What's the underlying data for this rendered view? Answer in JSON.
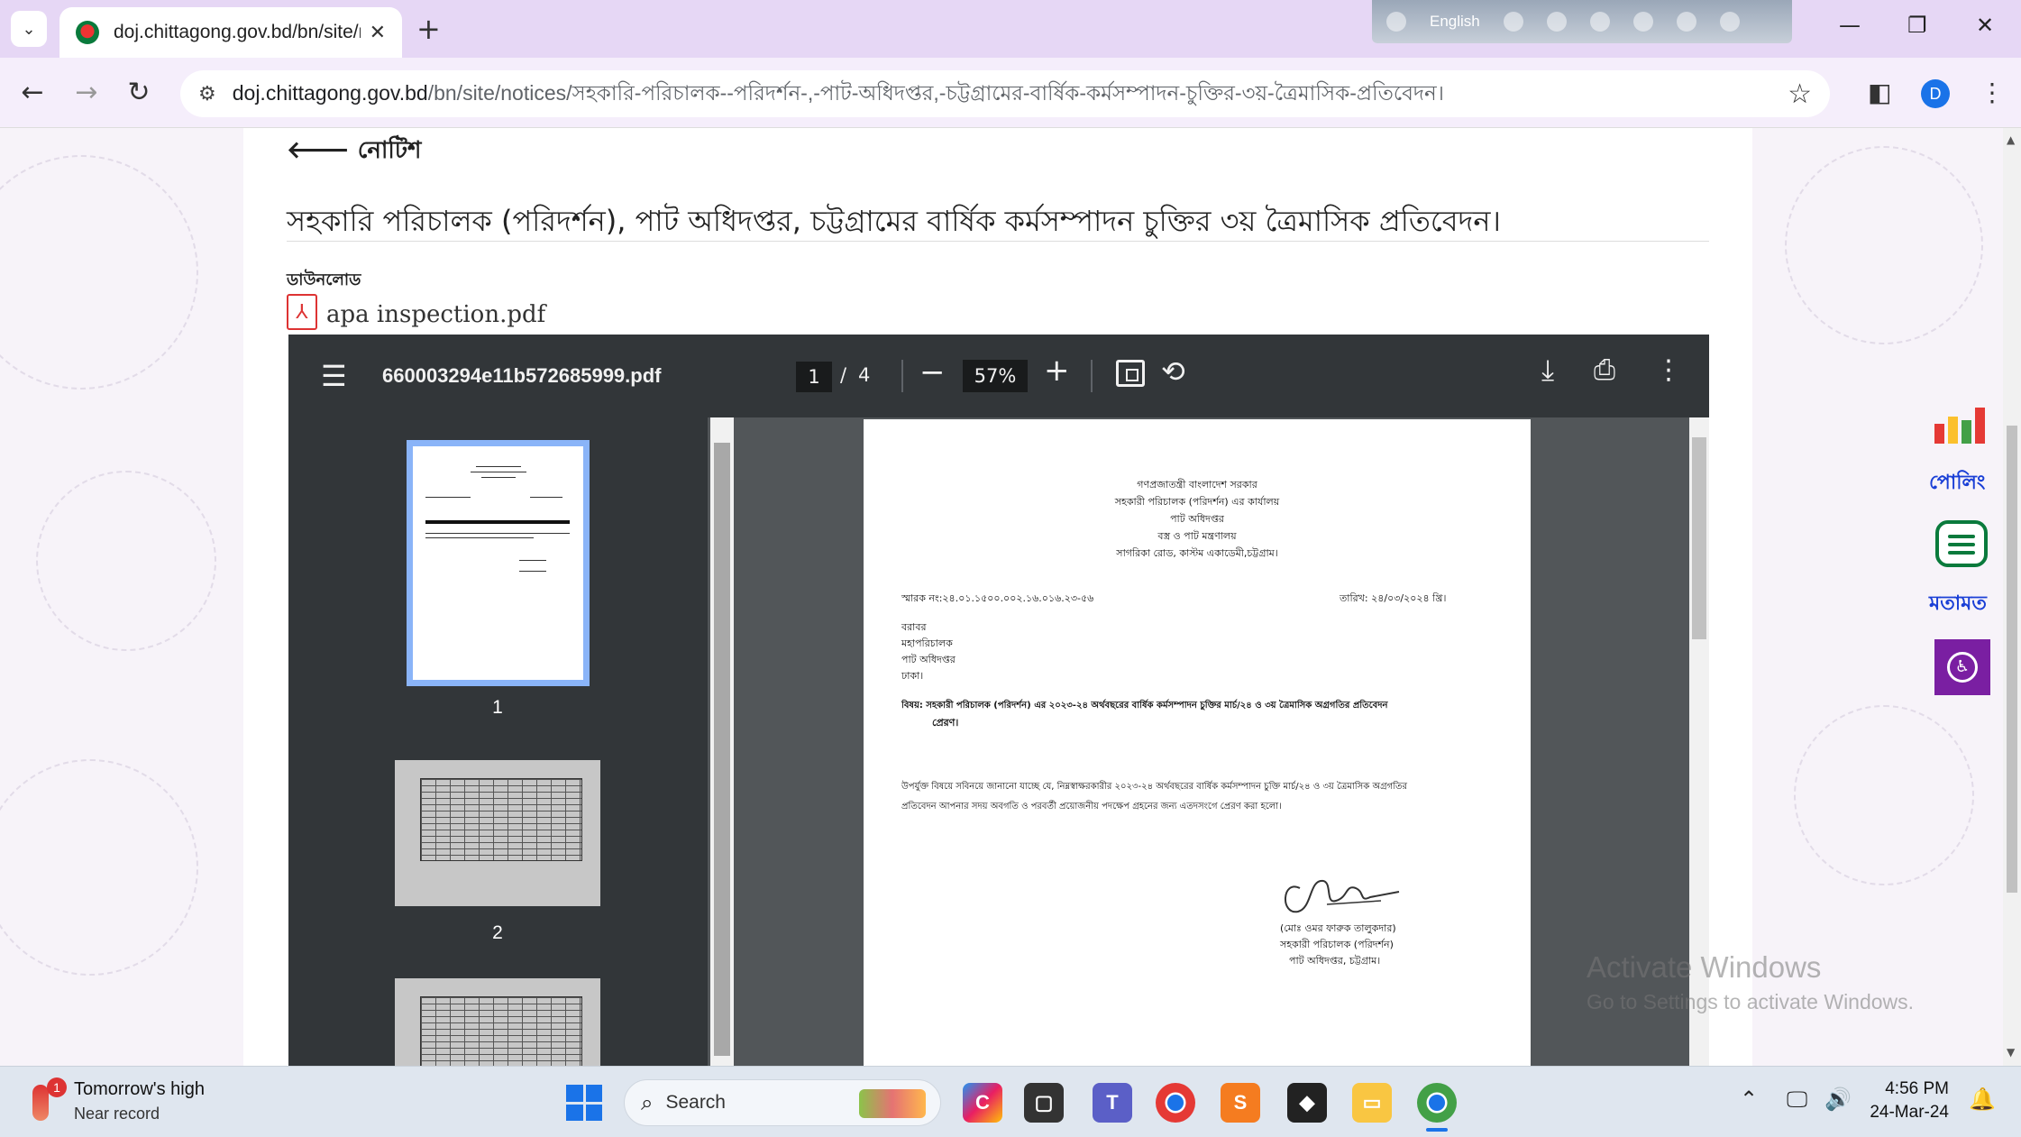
{
  "browser": {
    "tab_title": "doj.chittagong.gov.bd/bn/site/n",
    "url_host": "doj.chittagong.gov.bd",
    "url_path": "/bn/site/notices/সহকারি-পরিচালক--পরিদর্শন-,-পাট-অধিদপ্তর,-চট্টগ্রামের-বার্ষিক-কর্মসম্পাদন-চুক্তির-৩য়-ত্রৈমাসিক-প্রতিবেদন।",
    "language_bar_label": "English",
    "profile_initial": "D"
  },
  "page": {
    "back_label": "নোটিশ",
    "notice_title": "সহকারি পরিচালক (পরিদর্শন), পাট অধিদপ্তর, চট্টগ্রামের বার্ষিক কর্মসম্পাদন চুক্তির ৩য় ত্রৈমাসিক প্রতিবেদন।",
    "download_label": "ডাউনলোড",
    "attachment_name": "apa inspection.pdf"
  },
  "pdf_viewer": {
    "file_name": "660003294e11b572685999.pdf",
    "current_page": "1",
    "page_separator": "/",
    "total_pages": "4",
    "zoom": "57%",
    "thumbnails": [
      {
        "number": "1"
      },
      {
        "number": "2"
      }
    ],
    "document": {
      "header_lines": [
        "গণপ্রজাতন্ত্রী বাংলাদেশ সরকার",
        "সহকারী পরিচালক (পরিদর্শন) এর কার্যালয়",
        "পাট অধিদপ্তর",
        "বস্ত্র ও পাট মন্ত্রণালয়",
        "সাগরিকা রোড, কাস্টম একাডেমী,চট্টগ্রাম।"
      ],
      "memo_no": "স্মারক নং:২৪.০১.১৫০০.০০২.১৬.০১৬.২৩-৫৬",
      "date": "তারিখ: ২৪/০৩/২০২৪ খ্রি।",
      "recipient_lines": [
        "বরাবর",
        "মহাপরিচালক",
        "পাট অধিদপ্তর",
        "ঢাকা।"
      ],
      "subject_line1": "বিষয়: সহকারী পরিচালক (পরিদর্শন) এর ২০২৩-২৪ অর্থবছরের বার্ষিক কর্মসম্পাদন চুক্তির মার্চ/২৪ ও ৩য় ত্রৈমাসিক অগ্রগতির প্রতিবেদন",
      "subject_line2": "প্রেরণ।",
      "body_line1": "উপর্যুক্ত বিষয়ে সবিনয়ে জানানো যাচ্ছে যে, নিম্নস্বাক্ষরকারীর ২০২৩-২৪ অর্থবছরের বার্ষিক কর্মসম্পাদন চুক্তি মার্চ/২৪ ও ৩য় ত্রৈমাসিক অগ্রগতির",
      "body_line2": "প্রতিবেদন আপনার সদয় অবগতি ও পরবর্তী প্রয়োজনীয় পদক্ষেপ গ্রহনের জন্য এতদসংগে প্রেরণ করা হলো।",
      "signature_lines": [
        "(মোঃ ওমর ফারুক তালুকদার)",
        "সহকারী পরিচালক (পরিদর্শন)",
        "পাট অধিদপ্তর, চট্টগ্রাম।"
      ]
    }
  },
  "widgets": {
    "poll_label": "পোলিং",
    "feedback_label": "মতামত"
  },
  "watermark": {
    "line1": "Activate Windows",
    "line2": "Go to Settings to activate Windows."
  },
  "taskbar": {
    "weather_title": "Tomorrow's high",
    "weather_subtitle": "Near record",
    "weather_badge": "1",
    "search_placeholder": "Search",
    "time": "4:56 PM",
    "date": "24-Mar-24"
  },
  "colors": {
    "tab_strip": "#e6d7f5",
    "pdf_toolbar": "#323639",
    "pdf_background": "#525659",
    "active_thumb_outline": "#8ab4f8",
    "accent_blue": "#1a73e8"
  }
}
